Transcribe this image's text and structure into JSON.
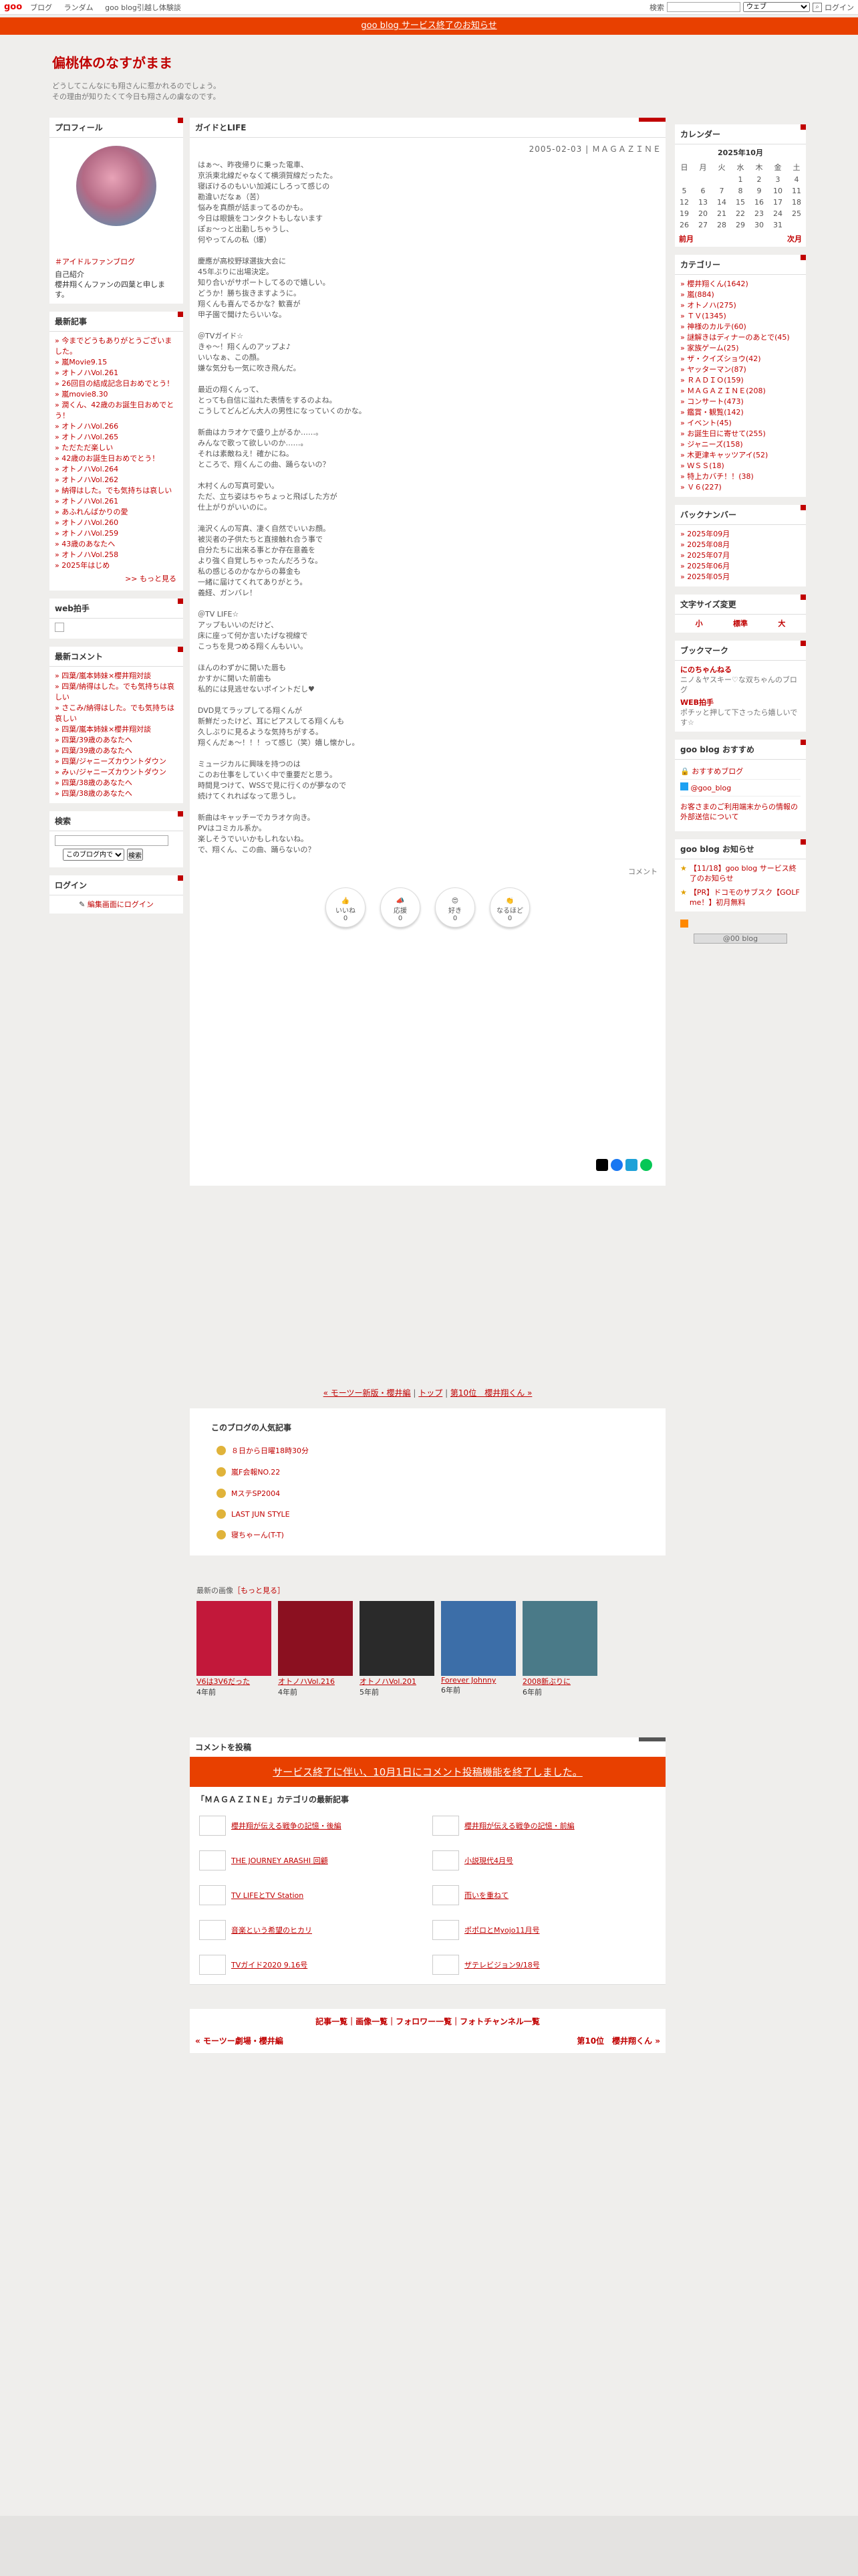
{
  "topbar": {
    "logo": "goo",
    "nav": [
      "ブログ",
      "ランダム",
      "goo blog引越し体験談"
    ],
    "search_label": "検索",
    "search_option": "ウェブ",
    "login": "ログイン"
  },
  "notice": "goo blog サービス終了のお知らせ",
  "blog": {
    "title": "偏桃体のなすがまま",
    "desc1": "どうしてこんなにも翔さんに惹かれるのでしょう。",
    "desc2": "その理由が知りたくて今日も翔さんの虜なのです。"
  },
  "profile": {
    "title": "プロフィール",
    "tag": "＃アイドルファンブログ",
    "intro_label": "自己紹介",
    "intro": "櫻井翔くんファンの四葉と申します。"
  },
  "recent": {
    "title": "最新記事",
    "items": [
      "今までどうもありがとうございました。",
      "嵐Movie9.15",
      "オトノハVol.261",
      "26回目の結成記念日おめでとう！",
      "嵐movie8.30",
      "潤くん、42歳のお誕生日おめでとう！",
      "オトノハVol.266",
      "オトノハVol.265",
      "ただただ楽しい",
      "42歳のお誕生日おめでとう！",
      "オトノハVol.264",
      "オトノハVol.262",
      "納得はした。でも気持ちは哀しい",
      "オトノハVol.261",
      "あふれんばかりの愛",
      "オトノハVol.260",
      "オトノハVol.259",
      "43歳のあなたへ",
      "オトノハVol.258",
      "2025年はじめ"
    ],
    "more": ">> もっと見る"
  },
  "webclap": {
    "title": "web拍手"
  },
  "comments": {
    "title": "最新コメント",
    "items": [
      "四葉/嵐本姉妹×櫻井翔対談",
      "四葉/納得はした。でも気持ちは哀しい",
      "さこみ/納得はした。でも気持ちは哀しい",
      "四葉/嵐本姉妹×櫻井翔対談",
      "四葉/39歳のあなたへ",
      "四葉/39歳のあなたへ",
      "四葉/ジャニーズカウントダウン",
      "みぃ/ジャニーズカウントダウン",
      "四葉/38歳のあなたへ",
      "四葉/38歳のあなたへ"
    ]
  },
  "search": {
    "title": "検索",
    "option": "このブログ内で",
    "button": "検索"
  },
  "login": {
    "title": "ログイン",
    "link": "編集画面にログイン"
  },
  "article": {
    "category": "ガイドとLIFE",
    "date": "2005-02-03 | ＭＡＧＡＺＩＮＥ",
    "paragraphs": [
      "はぁ〜、昨夜帰りに乗った電車、\n京浜東北線だゃなくて横須賀線だったた。\n寝ぼけるのもいい加減にしろって感じの\n勘違いだなぁ（苦）\n悩みを真顔が話まってるのかも。\n今日は眼鏡をコンタクトもしないます\nぽぉ〜っと出勤しちゃうし、\n何やってんの私（爆）",
      "慶應が高校野球選抜大会に\n45年ぶりに出場決定。\n知り合いがサポートしてるので嬉しい。\nどうか！勝ち抜きますように。\n翔くんも喜んでるかな？歓喜が\n甲子園で聞けたらいいな。",
      "＠TVガイド☆\nきゃ〜！翔くんのアップよ♪\nいいなぁ、この顔。\n嫌な気分も一気に吹き飛んだ。",
      "最近の翔くんって、\nとっても自信に溢れた表情をするのよね。\nこうしてどんどん大人の男性になっていくのかな。",
      "新曲はカラオケで盛り上がるか……。\nみんなで歌って欲しいのか……。\nそれは素敵ねえ！確かにね。\nところで、翔くんこの曲、踊らないの？",
      "木村くんの写真可愛い。\nただ、立ち姿はちゃちょっと飛ばした方が\n仕上がりがいいのに。",
      "滝沢くんの写真、凄く自然でいいお顔。\n被災者の子供たちと直接触れ合う事で\n自分たちに出来る事とか存在意義を\nより強く自覚しちゃったんだろうな。\n私の感じるのかなからの募金も\n一緒に届けてくれてありがとう。\n義経、ガンバレ！",
      "＠TV LIFE☆\nアップもいいのだけど、\n床に座って何か言いたげな視線で\nこっちを見つめる翔くんもいい。",
      "ほんのわずかに開いた唇も\nかすかに開いた前歯も\n私的には見逃せないポイントだし♥",
      "DVD見てラップしてる翔くんが\n新鮮だったけど、耳にピアスしてる翔くんも\n久しぶりに見るような気持ちがする。\n翔くんだぁ〜！！！って感じ（笑）嬉し懐かし。",
      "ミュージカルに興味を持つのは\nこのお仕事をしていく中で重要だと思う。\n時間見つけて、WSSで見に行くのが夢なので\n続けてくれればなって思うし。",
      "新曲はキャッチーでカラオケ向き。\nPVはコミカル系か。\n楽しそうでいいかもしれないね。\nで、翔くん、この曲、踊らないの？"
    ],
    "comment_link": "コメント",
    "reactions": [
      {
        "icon": "👍",
        "top": "いいね",
        "count": "0"
      },
      {
        "icon": "📣",
        "top": "応援",
        "count": "0"
      },
      {
        "icon": "😍",
        "top": "好き",
        "count": "0"
      },
      {
        "icon": "👏",
        "top": "なるほど",
        "count": "0"
      }
    ]
  },
  "pager": {
    "prev": "« モーツー新版・櫻井編",
    "top": "トップ",
    "next": "第10位　櫻井翔くん »"
  },
  "popular": {
    "title": "このブログの人気記事",
    "items": [
      "８日から日曜18時30分",
      "嵐F会報NO.22",
      "MステSP2004",
      "LAST JUN STYLE",
      "寝ちゃーん(T-T)"
    ]
  },
  "images": {
    "title": "最新の画像",
    "more": "［もっと見る］",
    "items": [
      {
        "label": "V6は3V6だった",
        "age": "4年前",
        "color": "#c2183a"
      },
      {
        "label": "オトノハVol.216",
        "age": "4年前",
        "color": "#8b1020"
      },
      {
        "label": "オトノハVol.201",
        "age": "5年前",
        "color": "#2a2a2a"
      },
      {
        "label": "Forever Johnny",
        "age": "6年前",
        "color": "#3c6ea8"
      },
      {
        "label": "2008新ぶりに",
        "age": "6年前",
        "color": "#4a7a88"
      }
    ]
  },
  "commentform": {
    "title": "コメントを投稿",
    "closed": "サービス終了に伴い、10月1日にコメント投稿機能を終了しました。"
  },
  "category_articles": {
    "title": "「ＭＡＧＡＺＩＮＥ」カテゴリの最新記事",
    "items": [
      "櫻井翔が伝える戦争の記憶・後編",
      "櫻井翔が伝える戦争の記憶・前編",
      "THE JOURNEY ARASHI 回顧",
      "小説現代4月号",
      "TV LIFEとTV Station",
      "而いを重ねて",
      "音楽という希望のヒカリ",
      "ポポロとMyojo11月号",
      "TVガイド2020 9.16号",
      "ザテレビジョン9/18号"
    ]
  },
  "footer": {
    "links": "記事一覧｜画像一覧｜フォロワー一覧｜フォトチャンネル一覧",
    "prev": "« モーツー劇場・櫻井編",
    "next": "第10位　櫻井翔くん »"
  },
  "calendar": {
    "title": "カレンダー",
    "month": "2025年10月",
    "days": [
      "日",
      "月",
      "火",
      "水",
      "木",
      "金",
      "土"
    ],
    "weeks": [
      [
        "",
        "",
        "",
        "1",
        "2",
        "3",
        "4"
      ],
      [
        "5",
        "6",
        "7",
        "8",
        "9",
        "10",
        "11"
      ],
      [
        "12",
        "13",
        "14",
        "15",
        "16",
        "17",
        "18"
      ],
      [
        "19",
        "20",
        "21",
        "22",
        "23",
        "24",
        "25"
      ],
      [
        "26",
        "27",
        "28",
        "29",
        "30",
        "31",
        ""
      ]
    ],
    "prev": "前月",
    "next": "次月"
  },
  "categories": {
    "title": "カテゴリー",
    "items": [
      "櫻井翔くん(1642)",
      "嵐(884)",
      "オトノハ(275)",
      "ＴＶ(1345)",
      "神様のカルテ(60)",
      "謎解きはディナーのあとで(45)",
      "家族ゲーム(25)",
      "ザ・クイズショウ(42)",
      "ヤッターマン(87)",
      "ＲＡＤＩＯ(159)",
      "ＭＡＧＡＺＩＮＥ(208)",
      "コンサート(473)",
      "鑑賞・観覧(142)",
      "イベント(45)",
      "お誕生日に寄せて(255)",
      "ジャニーズ(158)",
      "木更津キャッツアイ(52)",
      "ＷＳＳ(18)",
      "特上カバチ！！(38)",
      "Ｖ６(227)"
    ]
  },
  "backnumber": {
    "title": "バックナンバー",
    "items": [
      "2025年09月",
      "2025年08月",
      "2025年07月",
      "2025年06月",
      "2025年05月"
    ]
  },
  "fontsize": {
    "title": "文字サイズ変更",
    "small": "小",
    "medium": "標準",
    "large": "大"
  },
  "bookmark": {
    "title": "ブックマーク",
    "items": [
      {
        "name": "にのちゃんねる",
        "desc": "ニノ＆ヤスキー♡な双ちゃんのブログ"
      },
      {
        "name": "WEB拍手",
        "desc": "ポチッと押して下さったら嬉しいです☆"
      }
    ]
  },
  "goorec": {
    "title": "goo blog おすすめ",
    "items": [
      "おすすめブログ",
      "@goo_blog"
    ],
    "note": "お客さまのご利用端末からの情報の外部送信について"
  },
  "gooinfo": {
    "title": "goo blog お知らせ",
    "items": [
      "【11/18】goo blog サービス終了のお知らせ",
      "【PR】ドコモのサブスク【GOLF me！】初月無料"
    ],
    "badge": "@00 blog"
  },
  "colors": {
    "accent": "#c00000",
    "notice": "#e84000"
  }
}
